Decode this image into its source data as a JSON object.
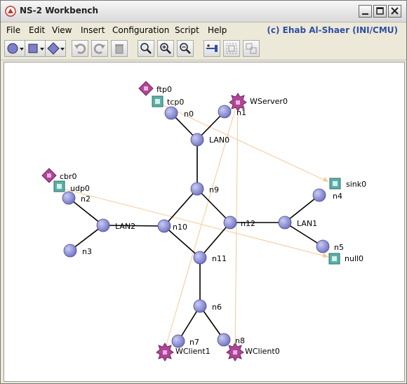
{
  "window": {
    "title": "NS-2 Workbench",
    "credit": "(c) Ehab Al-Shaer (INI/CMU)",
    "credit_color": "#2f4fa5",
    "title_icon": "ns2-app-icon"
  },
  "menu": {
    "items": [
      "File",
      "Edit",
      "View",
      "Insert",
      "Configuration",
      "Script",
      "Help"
    ]
  },
  "toolbar": {
    "icons": [
      "node-circle-icon",
      "rectangle-shape-icon",
      "diamond-shape-icon",
      "undo-icon",
      "redo-icon",
      "trash-icon",
      "zoom-icon",
      "zoom-in-icon",
      "zoom-out-icon",
      "add-link-icon",
      "group-icon",
      "ungroup-icon"
    ]
  },
  "topology": {
    "colors": {
      "node": "#7c7fd0",
      "link": "#000000",
      "traffic": "#f5c89a",
      "agent": "#5bb0a8",
      "app": "#b2449a"
    },
    "nodes": [
      "n0",
      "n1",
      "LAN0",
      "n9",
      "n2",
      "n3",
      "LAN2",
      "n10",
      "n12",
      "LAN1",
      "n4",
      "n5",
      "n11",
      "n6",
      "n7",
      "n8"
    ],
    "agents": [
      "tcp0",
      "udp0",
      "sink0",
      "null0"
    ],
    "applications": [
      "ftp0",
      "cbr0"
    ],
    "servers": [
      "WServer0"
    ],
    "clients": [
      "WClient1",
      "WClient0"
    ]
  }
}
